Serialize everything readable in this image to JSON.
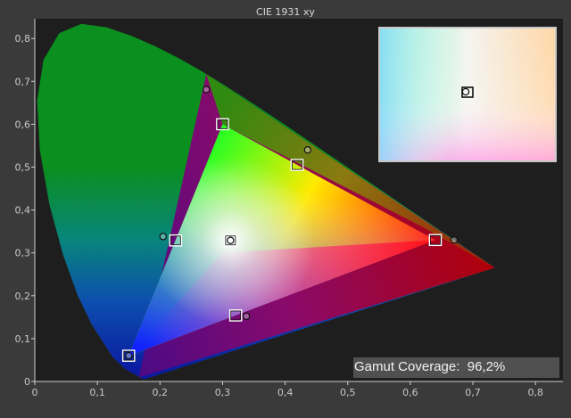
{
  "chart_data": {
    "type": "scatter",
    "title": "CIE 1931 xy",
    "xlabel": "",
    "ylabel": "",
    "xlim": [
      0,
      0.85
    ],
    "ylim": [
      0,
      0.85
    ],
    "x_ticks": [
      "0",
      "0,1",
      "0,2",
      "0,3",
      "0,4",
      "0,5",
      "0,6",
      "0,7",
      "0,8"
    ],
    "y_ticks": [
      "0",
      "0,1",
      "0,2",
      "0,3",
      "0,4",
      "0,5",
      "0,6",
      "0,7",
      "0,8"
    ],
    "grid": false,
    "reference_gamut": [
      [
        0.64,
        0.33
      ],
      [
        0.3,
        0.6
      ],
      [
        0.15,
        0.06
      ]
    ],
    "measured_gamut": [
      [
        0.735,
        0.265
      ],
      [
        0.274,
        0.717
      ],
      [
        0.166,
        0.009
      ]
    ],
    "targets": [
      {
        "x": 0.64,
        "y": 0.33
      },
      {
        "x": 0.3,
        "y": 0.6
      },
      {
        "x": 0.15,
        "y": 0.06
      },
      {
        "x": 0.225,
        "y": 0.329
      },
      {
        "x": 0.321,
        "y": 0.154
      },
      {
        "x": 0.419,
        "y": 0.505
      },
      {
        "x": 0.3127,
        "y": 0.329
      }
    ],
    "measured": [
      {
        "x": 0.67,
        "y": 0.33
      },
      {
        "x": 0.274,
        "y": 0.681
      },
      {
        "x": 0.15,
        "y": 0.06
      },
      {
        "x": 0.205,
        "y": 0.338
      },
      {
        "x": 0.338,
        "y": 0.152
      },
      {
        "x": 0.436,
        "y": 0.54
      },
      {
        "x": 0.3127,
        "y": 0.329
      }
    ],
    "gamut_coverage": "96,2%"
  },
  "labels": {
    "title": "CIE 1931 xy",
    "gamut_coverage": "Gamut Coverage:  96,2%"
  }
}
